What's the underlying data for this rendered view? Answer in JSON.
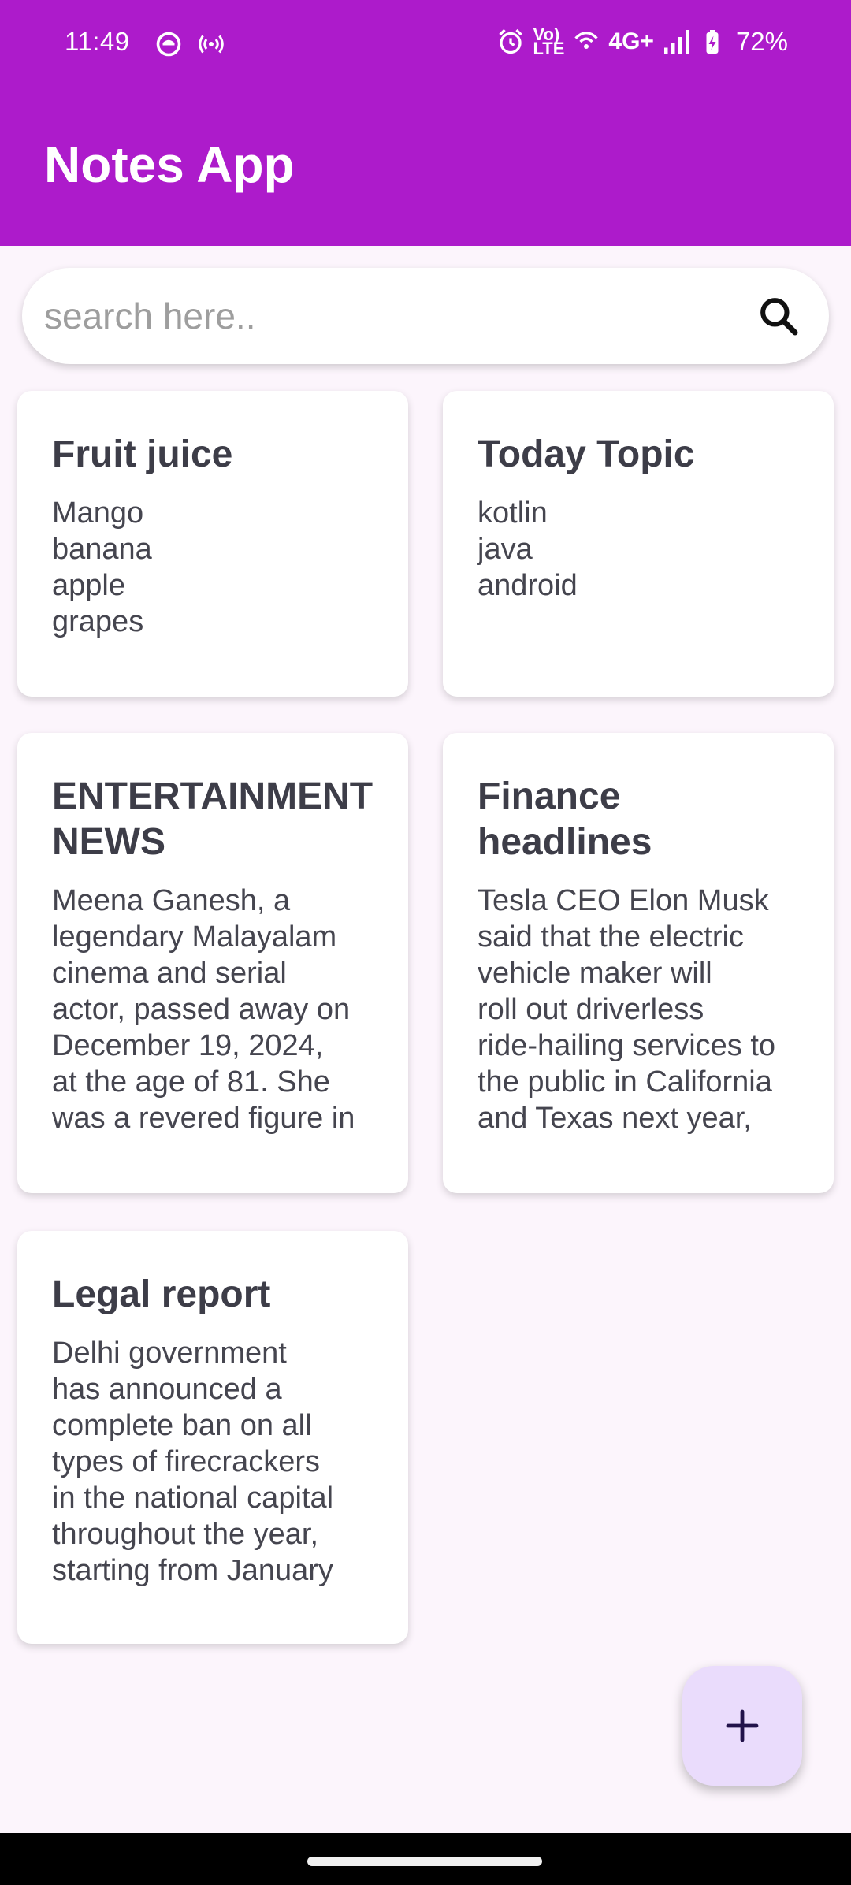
{
  "status_bar": {
    "time": "11:49",
    "network": "4G+",
    "volte_top": "Vo)",
    "volte_bottom": "LTE",
    "battery": "72%"
  },
  "app_bar": {
    "title": "Notes App"
  },
  "search": {
    "placeholder": "search here..",
    "value": ""
  },
  "notes": [
    {
      "title": "Fruit juice",
      "body": "Mango\nbanana\napple\ngrapes"
    },
    {
      "title": "Today Topic",
      "body": "kotlin\njava\nandroid"
    },
    {
      "title": "ENTERTAINMENT NEWS",
      "body": "Meena Ganesh, a\nlegendary Malayalam\ncinema and serial\nactor, passed away on\nDecember 19, 2024,\nat the age of 81. She\nwas a revered figure in"
    },
    {
      "title": "Finance headlines",
      "body": "Tesla CEO Elon Musk\nsaid that the electric\nvehicle maker will\nroll out driverless\nride-hailing services to\nthe public in California\nand Texas next year,"
    },
    {
      "title": "Legal report",
      "body": "Delhi government\nhas announced a\ncomplete ban on all\ntypes of firecrackers\nin the national capital\nthroughout the year,\nstarting from January"
    }
  ],
  "fab": {
    "icon": "plus-icon"
  },
  "colors": {
    "app_bar": "#ad1bcb",
    "background": "#fcf5fc",
    "fab": "#eadcfc"
  }
}
